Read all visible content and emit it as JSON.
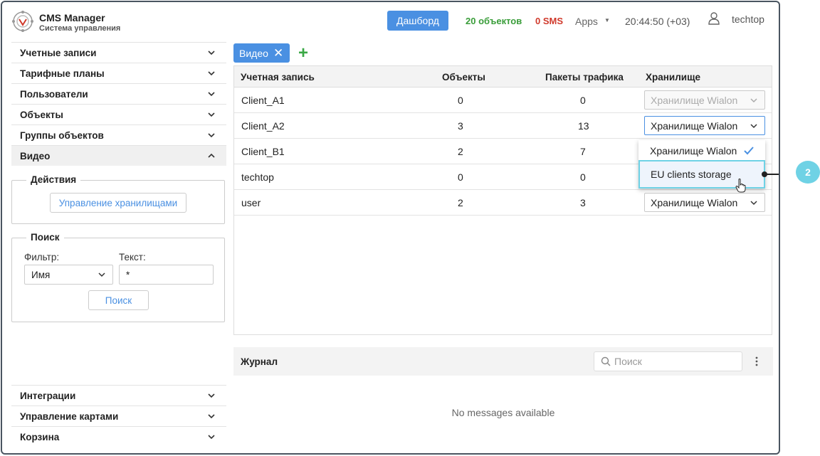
{
  "header": {
    "brand_title": "CMS Manager",
    "brand_subtitle": "Система управления",
    "dashboard_label": "Дашборд",
    "objects_count": "20 объектов",
    "sms_count": "0 SMS",
    "apps_label": "Apps",
    "time": "20:44:50 (+03)",
    "username": "techtop"
  },
  "sidebar": {
    "items_top": [
      {
        "label": "Учетные записи"
      },
      {
        "label": "Тарифные планы"
      },
      {
        "label": "Пользователи"
      },
      {
        "label": "Объекты"
      },
      {
        "label": "Группы объектов"
      },
      {
        "label": "Видео"
      }
    ],
    "actions": {
      "legend": "Действия",
      "manage_storage_label": "Управление хранилищами"
    },
    "search": {
      "legend": "Поиск",
      "filter_label": "Фильтр:",
      "filter_value": "Имя",
      "text_label": "Текст:",
      "text_value": "*",
      "search_button": "Поиск"
    },
    "items_bottom": [
      {
        "label": "Интеграции"
      },
      {
        "label": "Управление картами"
      },
      {
        "label": "Корзина"
      }
    ]
  },
  "tabs": [
    {
      "label": "Видео"
    }
  ],
  "table": {
    "columns": [
      "Учетная запись",
      "Объекты",
      "Пакеты трафика",
      "Хранилище"
    ],
    "rows": [
      {
        "account": "Client_A1",
        "objects": "0",
        "packets": "0",
        "storage": "Хранилище Wialon"
      },
      {
        "account": "Client_A2",
        "objects": "3",
        "packets": "13",
        "storage": "Хранилище Wialon"
      },
      {
        "account": "Client_B1",
        "objects": "2",
        "packets": "7",
        "storage": ""
      },
      {
        "account": "techtop",
        "objects": "0",
        "packets": "0",
        "storage": ""
      },
      {
        "account": "user",
        "objects": "2",
        "packets": "3",
        "storage": "Хранилище Wialon"
      }
    ]
  },
  "dropdown": {
    "options": [
      "Хранилище Wialon",
      "EU clients storage"
    ],
    "selected": "Хранилище Wialon"
  },
  "callout": {
    "number": "2"
  },
  "journal": {
    "title": "Журнал",
    "search_placeholder": "Поиск",
    "empty_message": "No messages available"
  },
  "colors": {
    "accent": "#4a90e2",
    "objects_green": "#3a9d3a",
    "sms_red": "#d0392b",
    "highlight_cyan": "#6fd2e5"
  }
}
